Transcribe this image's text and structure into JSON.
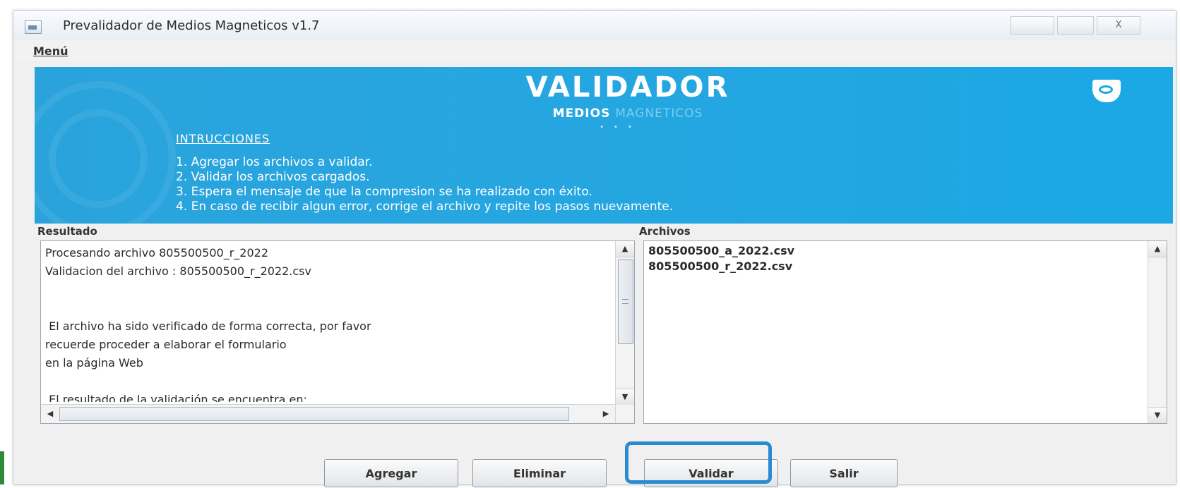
{
  "window": {
    "title": "Prevalidador de Medios Magneticos v1.7",
    "controls": {
      "minimize": "",
      "maximize": "",
      "close": "X"
    }
  },
  "menubar": {
    "items": [
      "Menú"
    ]
  },
  "banner": {
    "title": "VALIDADOR",
    "subtitle_bold": "MEDIOS",
    "subtitle_light": "MAGNETICOS",
    "dots": "•••",
    "org_label": "",
    "instructions_heading": "INTRUCCIONES",
    "instructions": [
      "1. Agregar los archivos a validar.",
      "2. Validar los archivos cargados.",
      "3. Espera el mensaje de que la compresion se ha realizado con éxito.",
      "4. En caso de recibir algun error, corrige el archivo y repite los pasos nuevamente."
    ]
  },
  "resultado": {
    "label": "Resultado",
    "text": "Procesando archivo 805500500_r_2022\nValidacion del archivo : 805500500_r_2022.csv\n\n\n El archivo ha sido verificado de forma correcta, por favor\nrecuerde proceder a elaborar el formulario\nen la página Web\n\n El resultado de la validación se encuentra en:\nD:\\Documentos del Sistema\\Desktop\\Medios Magneticos Ca\n*******************************************"
  },
  "archivos": {
    "label": "Archivos",
    "files": [
      "805500500_a_2022.csv",
      "805500500_r_2022.csv"
    ]
  },
  "buttons": {
    "agregar": "Agregar",
    "eliminar": "Eliminar",
    "validar": "Validar",
    "salir": "Salir"
  },
  "colors": {
    "banner": "#26a6e0",
    "focus": "#2a8bd1",
    "window_bg": "#f0f0f0"
  },
  "icons": {
    "app": "window-app-icon",
    "org": "shield-icon"
  }
}
